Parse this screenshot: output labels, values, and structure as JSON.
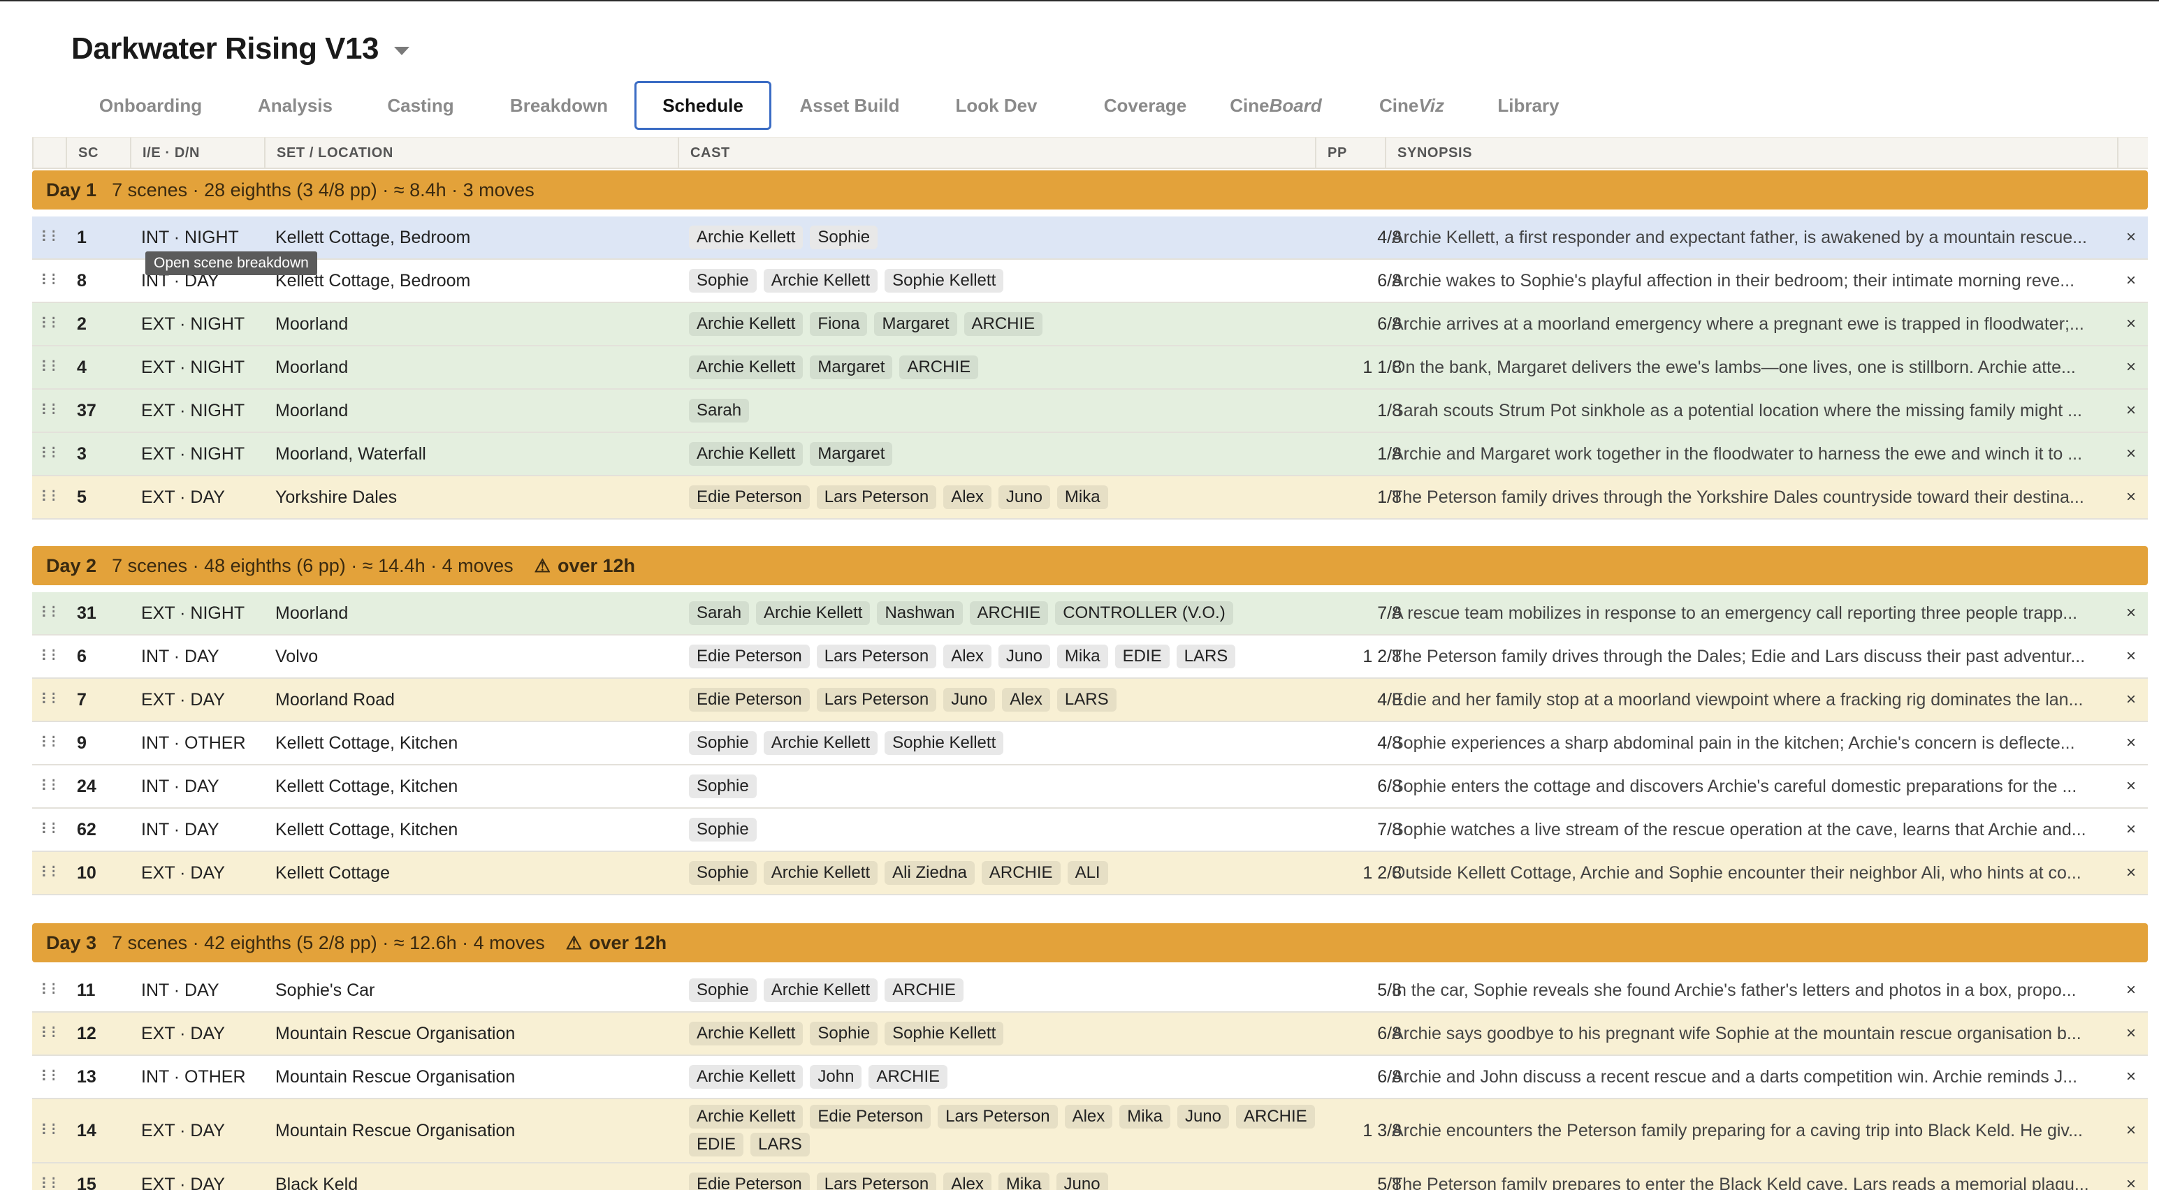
{
  "app": {
    "title": "Darkwater Rising V13"
  },
  "tabs": [
    {
      "label": "Onboarding"
    },
    {
      "label": "Analysis"
    },
    {
      "label": "Casting"
    },
    {
      "label": "Breakdown"
    },
    {
      "label": "Schedule",
      "active": true
    },
    {
      "label": "Asset Build"
    },
    {
      "label": "Look Dev"
    },
    {
      "label": "Coverage"
    },
    {
      "label_pre": "Cine",
      "label_ital": "Board"
    },
    {
      "label_pre": "Cine",
      "label_ital": "Viz"
    },
    {
      "label": "Library"
    }
  ],
  "columns": {
    "sc": "SC",
    "ie": "I/E · D/N",
    "loc": "SET / LOCATION",
    "cast": "CAST",
    "pp": "PP",
    "syn": "SYNOPSIS"
  },
  "tooltip": "Open scene breakdown",
  "colors": {
    "accent": "#3b6cc4",
    "day_band": "#e3a23a",
    "ext_night": "#e4efdf",
    "ext_day": "#f8f0d4",
    "selected": "#dde6f5"
  },
  "icons": {
    "drag": "drag-handle-icon",
    "remove": "close-icon",
    "warning": "warning-icon",
    "caret": "chevron-down-icon"
  },
  "days": [
    {
      "label": "Day 1",
      "summary": "7 scenes · 28 eighths (3 4/8 pp) · ≈ 8.4h · 3 moves",
      "warning": "",
      "rows": [
        {
          "sc": "1",
          "ie": "INT · NIGHT",
          "loc": "Kellett Cottage, Bedroom",
          "cast": [
            "Archie Kellett",
            "Sophie"
          ],
          "pp": "4/8",
          "syn": "Archie Kellett, a first responder and expectant father, is awakened by a mountain rescue...",
          "kind": "selected"
        },
        {
          "sc": "8",
          "ie": "INT · DAY",
          "loc": "Kellett Cottage, Bedroom",
          "cast": [
            "Sophie",
            "Archie Kellett",
            "Sophie Kellett"
          ],
          "pp": "6/8",
          "syn": "Archie wakes to Sophie's playful affection in their bedroom; their intimate morning reve...",
          "kind": "int"
        },
        {
          "sc": "2",
          "ie": "EXT · NIGHT",
          "loc": "Moorland",
          "cast": [
            "Archie Kellett",
            "Fiona",
            "Margaret",
            "ARCHIE"
          ],
          "pp": "6/8",
          "syn": "Archie arrives at a moorland emergency where a pregnant ewe is trapped in floodwater;...",
          "kind": "ext-night"
        },
        {
          "sc": "4",
          "ie": "EXT · NIGHT",
          "loc": "Moorland",
          "cast": [
            "Archie Kellett",
            "Margaret",
            "ARCHIE"
          ],
          "pp": "1 1/8",
          "syn": "On the bank, Margaret delivers the ewe's lambs—one lives, one is stillborn. Archie atte...",
          "kind": "ext-night"
        },
        {
          "sc": "37",
          "ie": "EXT · NIGHT",
          "loc": "Moorland",
          "cast": [
            "Sarah"
          ],
          "pp": "1/8",
          "syn": "Sarah scouts Strum Pot sinkhole as a potential location where the missing family might ...",
          "kind": "ext-night"
        },
        {
          "sc": "3",
          "ie": "EXT · NIGHT",
          "loc": "Moorland, Waterfall",
          "cast": [
            "Archie Kellett",
            "Margaret"
          ],
          "pp": "1/8",
          "syn": "Archie and Margaret work together in the floodwater to harness the ewe and winch it to ...",
          "kind": "ext-night"
        },
        {
          "sc": "5",
          "ie": "EXT · DAY",
          "loc": "Yorkshire Dales",
          "cast": [
            "Edie Peterson",
            "Lars Peterson",
            "Alex",
            "Juno",
            "Mika"
          ],
          "pp": "1/8",
          "syn": "The Peterson family drives through the Yorkshire Dales countryside toward their destina...",
          "kind": "ext-day"
        }
      ]
    },
    {
      "label": "Day 2",
      "summary": "7 scenes · 48 eighths (6 pp) · ≈ 14.4h · 4 moves",
      "warning": "over 12h",
      "rows": [
        {
          "sc": "31",
          "ie": "EXT · NIGHT",
          "loc": "Moorland",
          "cast": [
            "Sarah",
            "Archie Kellett",
            "Nashwan",
            "ARCHIE",
            "CONTROLLER (V.O.)"
          ],
          "pp": "7/8",
          "syn": "A rescue team mobilizes in response to an emergency call reporting three people trapp...",
          "kind": "ext-night"
        },
        {
          "sc": "6",
          "ie": "INT · DAY",
          "loc": "Volvo",
          "cast": [
            "Edie Peterson",
            "Lars Peterson",
            "Alex",
            "Juno",
            "Mika",
            "EDIE",
            "LARS"
          ],
          "pp": "1 2/8",
          "syn": "The Peterson family drives through the Dales; Edie and Lars discuss their past adventur...",
          "kind": "int"
        },
        {
          "sc": "7",
          "ie": "EXT · DAY",
          "loc": "Moorland Road",
          "cast": [
            "Edie Peterson",
            "Lars Peterson",
            "Juno",
            "Alex",
            "LARS"
          ],
          "pp": "4/8",
          "syn": "Edie and her family stop at a moorland viewpoint where a fracking rig dominates the lan...",
          "kind": "ext-day"
        },
        {
          "sc": "9",
          "ie": "INT · OTHER",
          "loc": "Kellett Cottage, Kitchen",
          "cast": [
            "Sophie",
            "Archie Kellett",
            "Sophie Kellett"
          ],
          "pp": "4/8",
          "syn": "Sophie experiences a sharp abdominal pain in the kitchen; Archie's concern is deflecte...",
          "kind": "int"
        },
        {
          "sc": "24",
          "ie": "INT · DAY",
          "loc": "Kellett Cottage, Kitchen",
          "cast": [
            "Sophie"
          ],
          "pp": "6/8",
          "syn": "Sophie enters the cottage and discovers Archie's careful domestic preparations for the ...",
          "kind": "int"
        },
        {
          "sc": "62",
          "ie": "INT · DAY",
          "loc": "Kellett Cottage, Kitchen",
          "cast": [
            "Sophie"
          ],
          "pp": "7/8",
          "syn": "Sophie watches a live stream of the rescue operation at the cave, learns that Archie and...",
          "kind": "int"
        },
        {
          "sc": "10",
          "ie": "EXT · DAY",
          "loc": "Kellett Cottage",
          "cast": [
            "Sophie",
            "Archie Kellett",
            "Ali Ziedna",
            "ARCHIE",
            "ALI"
          ],
          "pp": "1 2/8",
          "syn": "Outside Kellett Cottage, Archie and Sophie encounter their neighbor Ali, who hints at co...",
          "kind": "ext-day"
        }
      ]
    },
    {
      "label": "Day 3",
      "summary": "7 scenes · 42 eighths (5 2/8 pp) · ≈ 12.6h · 4 moves",
      "warning": "over 12h",
      "rows": [
        {
          "sc": "11",
          "ie": "INT · DAY",
          "loc": "Sophie's Car",
          "cast": [
            "Sophie",
            "Archie Kellett",
            "ARCHIE"
          ],
          "pp": "5/8",
          "syn": "In the car, Sophie reveals she found Archie's father's letters and photos in a box, propo...",
          "kind": "int"
        },
        {
          "sc": "12",
          "ie": "EXT · DAY",
          "loc": "Mountain Rescue Organisation",
          "cast": [
            "Archie Kellett",
            "Sophie",
            "Sophie Kellett"
          ],
          "pp": "6/8",
          "syn": "Archie says goodbye to his pregnant wife Sophie at the mountain rescue organisation b...",
          "kind": "ext-day"
        },
        {
          "sc": "13",
          "ie": "INT · OTHER",
          "loc": "Mountain Rescue Organisation",
          "cast": [
            "Archie Kellett",
            "John",
            "ARCHIE"
          ],
          "pp": "6/8",
          "syn": "Archie and John discuss a recent rescue and a darts competition win. Archie reminds J...",
          "kind": "int"
        },
        {
          "sc": "14",
          "ie": "EXT · DAY",
          "loc": "Mountain Rescue Organisation",
          "cast": [
            "Archie Kellett",
            "Edie Peterson",
            "Lars Peterson",
            "Alex",
            "Mika",
            "Juno",
            "ARCHIE",
            "EDIE",
            "LARS"
          ],
          "pp": "1 3/8",
          "syn": "Archie encounters the Peterson family preparing for a caving trip into Black Keld. He giv...",
          "kind": "ext-day",
          "tall": true
        },
        {
          "sc": "15",
          "ie": "EXT · DAY",
          "loc": "Black Keld",
          "cast": [
            "Edie Peterson",
            "Lars Peterson",
            "Alex",
            "Mika",
            "Juno"
          ],
          "pp": "5/8",
          "syn": "The Peterson family prepares to enter the Black Keld cave. Lars reads a memorial plaqu...",
          "kind": "ext-day"
        }
      ]
    }
  ]
}
